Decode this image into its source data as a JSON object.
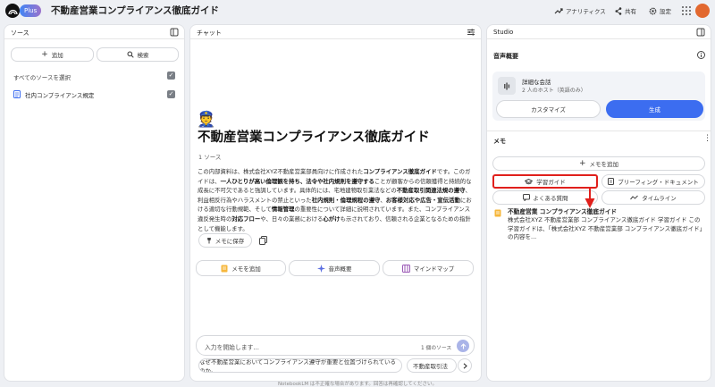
{
  "app": {
    "badge": "Plus",
    "title": "不動産営業コンプライアンス徹底ガイド"
  },
  "header": {
    "analytics": "アナリティクス",
    "share": "共有",
    "settings": "設定"
  },
  "sources": {
    "title": "ソース",
    "add": "追加",
    "search": "検索",
    "select_all": "すべてのソースを選択",
    "items": [
      {
        "label": "社内コンプライアンス規定",
        "checked": true
      }
    ]
  },
  "chat": {
    "title": "チャット",
    "emoji": "👮",
    "heading": "不動産営業コンプライアンス徹底ガイド",
    "source_count": "1 ソース",
    "summary": {
      "p1": "この内部資料は、株式会社XYZ不動産営業部員向けに作成された",
      "b1": "コンプライアンス徹底ガイド",
      "p2": "です。このガイドは、",
      "b2": "一人ひとりが高い倫理観を持ち、法令や社内規則を遵守する",
      "p3": "ことが顧客からの信頼獲得と持続的な成長に不可欠であると強調しています。具体的には、宅地建物取引業法などの",
      "b3": "不動産取引関連法規の遵守",
      "p4": "、利益相反行為やハラスメントの禁止といった",
      "b4": "社内規則・倫理規程の遵守",
      "p5": "、",
      "b5": "お客様対応や広告・宣伝活動",
      "p6": "における適切な行動規範、そして",
      "b6": "情報管理",
      "p7": "の重要性について詳細に説明されています。また、コンプライアンス違反発生時の",
      "b7": "対応フロー",
      "p8": "や、日々の業務における",
      "b8": "心がけ",
      "p9": "も示されており、信頼される企業となるための指針として機能します。"
    },
    "save_note": "メモに保存",
    "actions": [
      "メモを追加",
      "音声概要",
      "マインドマップ"
    ],
    "input_placeholder": "入力を開始します...",
    "input_sources": "1 個のソース",
    "suggestions": [
      "なぜ不動産営業においてコンプライアンス遵守が重要と位置づけられているのか。",
      "不動産取引法"
    ],
    "footer": "NotebookLM は不正確な場合があります。回答は再確認してください。"
  },
  "studio": {
    "title": "Studio",
    "audio_title": "音声概要",
    "audio_card_title": "詳細な会話",
    "audio_card_sub": "2 人のホスト（英語のみ）",
    "customize": "カスタマイズ",
    "generate": "生成",
    "memo_title": "メモ",
    "add_memo": "メモを追加",
    "study_guide": "学習ガイド",
    "briefing": "ブリーフィング・ドキュメント",
    "faq": "よくある質問",
    "timeline": "タイムライン",
    "note_title": "不動産営業 コンプライアンス徹底ガイド",
    "note_body": "株式会社XYZ 不動産営業部 コンプライアンス徹底ガイド 学習ガイド この学習ガイドは、「株式会社XYZ 不動産営業部 コンプライアンス徹底ガイド」の内容を..."
  },
  "colors": {
    "accent": "#3c6df0",
    "highlight": "#e0201c"
  }
}
